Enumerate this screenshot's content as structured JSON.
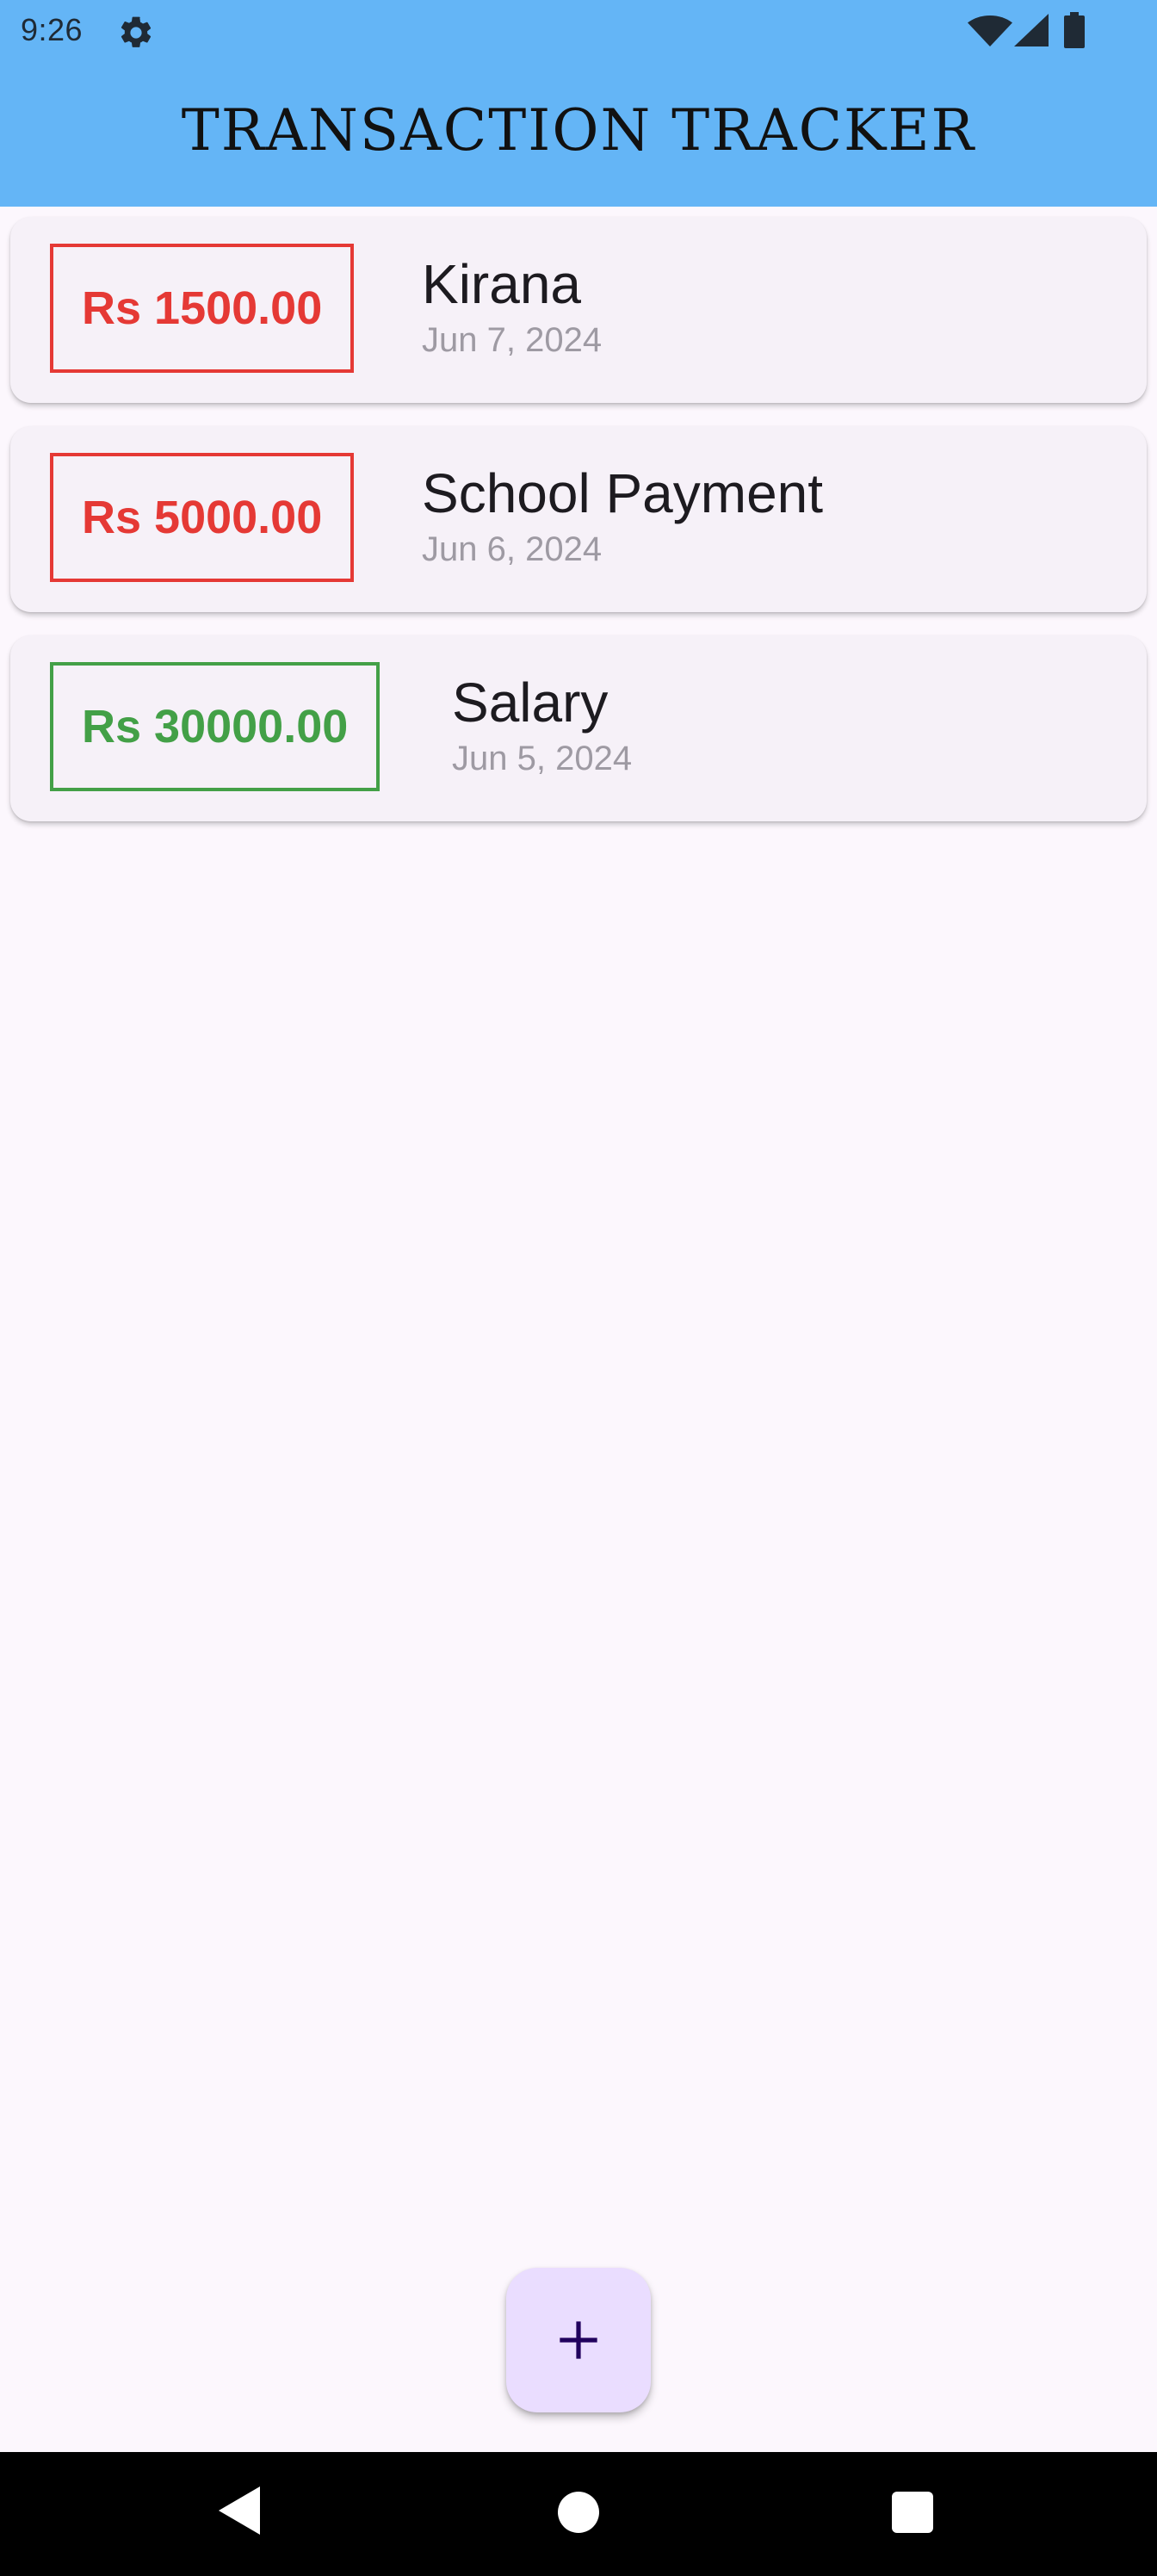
{
  "status_bar": {
    "time": "9:26",
    "icons": [
      "gear-icon",
      "wifi-icon",
      "signal-icon",
      "battery-icon"
    ]
  },
  "app_bar": {
    "title": "TRANSACTION TRACKER",
    "background_color": "#64b5f6"
  },
  "transactions": [
    {
      "amount": "Rs 1500.00",
      "title": "Kirana",
      "date": "Jun 7, 2024",
      "type": "expense"
    },
    {
      "amount": "Rs 5000.00",
      "title": "School Payment",
      "date": "Jun 6, 2024",
      "type": "expense"
    },
    {
      "amount": "Rs 30000.00",
      "title": "Salary",
      "date": "Jun 5, 2024",
      "type": "income"
    }
  ],
  "colors": {
    "expense": "#e53935",
    "income": "#43a047",
    "fab_background": "#eaddff"
  },
  "fab": {
    "icon": "plus-icon"
  },
  "nav_bar": {
    "icons": [
      "back-icon",
      "home-icon",
      "recents-icon"
    ]
  }
}
